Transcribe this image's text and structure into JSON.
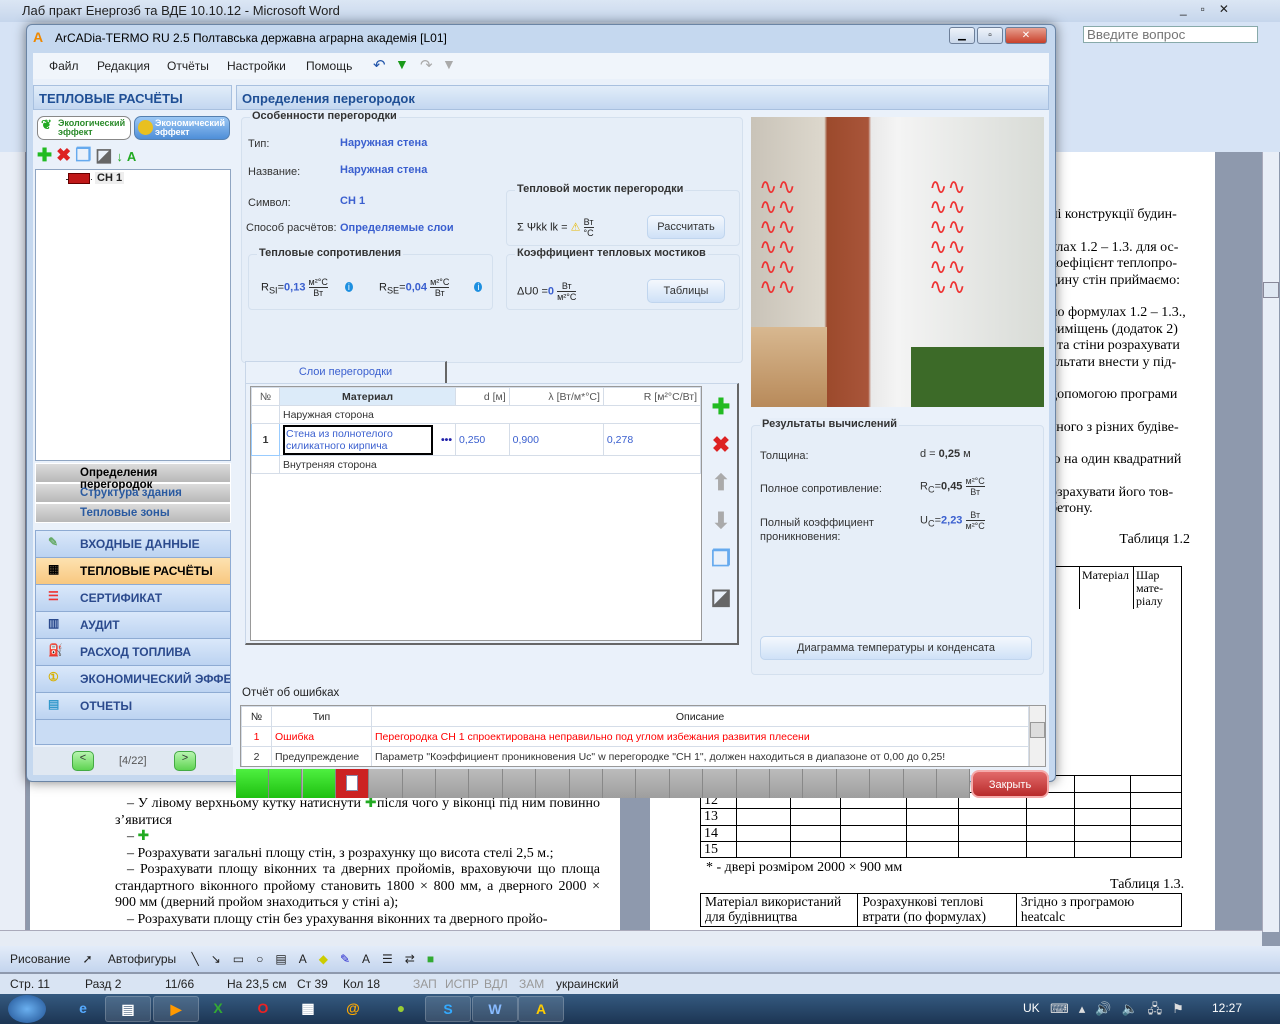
{
  "word": {
    "title": "Лаб практ Енергозб та ВДЕ 10.10.12 - Microsoft Word",
    "ask_placeholder": "Введите вопрос",
    "left_text": [
      "– У лівому верхньому кутку натиснути",
      "після чого у віконці під ним повинно з’явитися",
      "–",
      "– Розрахувати загальні площу стін, з розрахунку що висота стелі 2,5 м.;",
      "– Розрахувати площу віконних та дверних пройомів, враховуючи що площа стандартного віконного пройому становить 1800 × 800 мм, а дверного 2000 × 900 мм (дверний пройом знаходиться у стіні а);",
      "– Розрахувати площу стін без урахування віконних та дверного пройо-"
    ],
    "right_text": [
      "ні конструкції будин-",
      "улах 1.2 – 1.3. для ос-",
      "коефіцієнт теплопро-",
      "дину стін приймаємо:",
      "по формулах 1.2 – 1.3.,",
      "риміщень (додаток 2)",
      ", та стіни розрахувати",
      "ультати внести у під-",
      "допомогою програми",
      "аного з різних будіве-",
      "ю на один квадратний",
      "озрахувати його тов-",
      "бетону."
    ],
    "table12_caption": "Таблиця 1.2",
    "table12_headers": [
      "Матеріал",
      "Шар мате-ріалу"
    ],
    "table12_rows": [
      "11",
      "12",
      "13",
      "14",
      "15"
    ],
    "footnote": "* - двері розміром 2000 × 900 мм",
    "table13_caption": "Таблиця 1.3.",
    "table13_headers": [
      "Матеріал використаний для будівництва",
      "Розрахункові теплові втрати (по формулах)",
      "Згідно з програмою heatcalc"
    ],
    "draw_toolbar": {
      "draw": "Рисование",
      "autoshapes": "Автофигуры"
    },
    "status": {
      "page": "Стр. 11",
      "section": "Разд 2",
      "pages": "11/66",
      "at": "На 23,5 см",
      "line": "Ст 39",
      "col": "Кол 18",
      "rec": "ЗАП",
      "trk": "ИСПР",
      "ext": "ВДЛ",
      "ovr": "ЗАМ",
      "lang": "украинский"
    }
  },
  "taskbar": {
    "lang": "UK",
    "time": "12:27"
  },
  "app": {
    "title": "ArCADia-TERMO RU 2.5 Полтавська державна аграрна академія [L01]",
    "menu": [
      "Файл",
      "Редакция",
      "Отчёты",
      "Настройки",
      "Помощь"
    ],
    "left_header": "ТЕПЛОВЫЕ РАСЧЁТЫ",
    "tabs": [
      "Экологический эффект",
      "Экономический эффект"
    ],
    "tree_item": "СН 1",
    "subnav": [
      "Определения перегородок",
      "Структура здания",
      "Тепловые зоны"
    ],
    "nav": [
      "ВХОДНЫЕ ДАННЫЕ",
      "ТЕПЛОВЫЕ РАСЧЁТЫ",
      "СЕРТИФИКАТ",
      "АУДИТ",
      "РАСХОД ТОПЛИВА",
      "ЭКОНОМИЧЕСКИЙ ЭФФЕКТ",
      "ОТЧЕТЫ"
    ],
    "nav_active": 1,
    "pager": "[4/22]",
    "main_header": "Определения перегородок",
    "features": {
      "title": "Особенности перегородки",
      "type_label": "Тип:",
      "type": "Наружная стена",
      "name_label": "Название:",
      "name": "Наружная стена",
      "symbol_label": "Символ:",
      "symbol": "СН 1",
      "method_label": "Способ расчётов:",
      "method": "Определяемые слои"
    },
    "resist": {
      "title": "Тепловые сопротивления",
      "rsi": "0,13",
      "rse": "0,04",
      "unit_num": "м²°С",
      "unit_den": "Вт"
    },
    "bridge": {
      "title": "Тепловой мостик перегородки",
      "formula": "Σ Ψkk lk =",
      "unit_num": "Вт",
      "unit_den": "°С",
      "button": "Рассчитать"
    },
    "bridge_coef": {
      "title": "Коэффициент тепловых мостиков",
      "formula": "ΔU0 =",
      "value": "0",
      "unit_num": "Вт",
      "unit_den": "м²°С",
      "button": "Таблицы"
    },
    "layers": {
      "tab": "Слои перегородки",
      "headers": [
        "№",
        "Материал",
        "d [м]",
        "λ [Вт/м*°С]",
        "R [м²°С/Вт]"
      ],
      "outer": "Наружная сторона",
      "inner": "Внутреняя сторона",
      "rows": [
        {
          "n": "1",
          "material": "Стена из полнотелого силикатного кирпича",
          "d": "0,250",
          "lambda": "0,900",
          "r": "0,278"
        }
      ]
    },
    "results": {
      "title": "Результаты вычислений",
      "thick_label": "Толщина:",
      "thick": "0,25",
      "thick_unit": "м",
      "rc_label": "Полное сопротивление:",
      "rc": "0,45",
      "uc_label": "Полный коэффициент проникновения:",
      "uc": "2,23",
      "diagram_button": "Диаграмма температуры и конденсата"
    },
    "errors": {
      "title": "Отчёт об ошибках",
      "headers": [
        "№",
        "Тип",
        "Описание"
      ],
      "rows": [
        {
          "n": "1",
          "type": "Ошибка",
          "desc": "Перегородка СН 1 спроектирована неправильно под углом избежания развития плесени",
          "color": "#ff0000"
        },
        {
          "n": "2",
          "type": "Предупреждение",
          "desc": "Параметр \"Коэффициент проникновения Uc\" w перегородке \"СН 1\", должен находиться в диапазоне от 0,00 до 0,25!",
          "color": "#333333"
        }
      ]
    },
    "progress": {
      "done_steps": 3,
      "total_steps": 22
    },
    "close": "Закрыть"
  }
}
